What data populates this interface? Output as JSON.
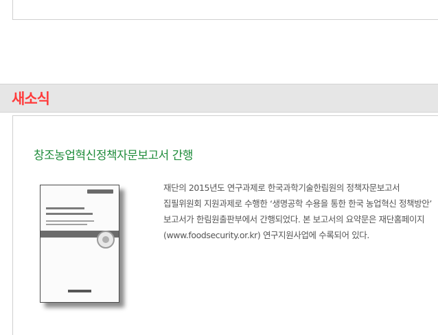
{
  "section": {
    "title": "새소식"
  },
  "article": {
    "title": "창조농업혁신정책자문보고서 간행",
    "description": "재단의 2015년도 연구과제로 한국과학기술한림원의  정책자문보고서 집필위원회 지원과제로 수행한 ‘생명공학 수용을 통한 한국 농업혁신 정책방안’ 보고서가 한림원출판부에서 간행되었다. 본 보고서의 요약문은 재단홈페이지(www.foodsecurity.or.kr) 연구지원사업에 수록되어 있다."
  },
  "colors": {
    "section_title": "#ff3b3b",
    "article_title": "#1f8c3b",
    "section_bar": "#e6e6e6",
    "body_text": "#555555"
  }
}
